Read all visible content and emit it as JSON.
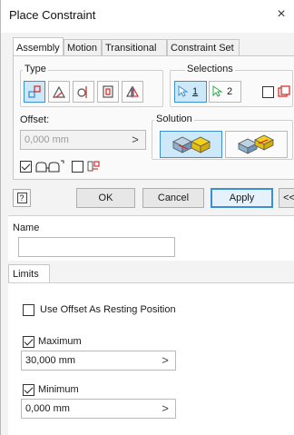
{
  "window": {
    "title": "Place Constraint",
    "close_glyph": "×"
  },
  "tabs": [
    {
      "label": "Assembly",
      "active": true
    },
    {
      "label": "Motion",
      "active": false
    },
    {
      "label": "Transitional",
      "active": false
    },
    {
      "label": "Constraint Set",
      "active": false
    }
  ],
  "type_group": {
    "label": "Type",
    "buttons": [
      "mate-icon",
      "angle-icon",
      "tangent-icon",
      "insert-icon",
      "symmetry-icon"
    ],
    "selected_index": 0
  },
  "selections_group": {
    "label": "Selections",
    "first_label": "1",
    "second_label": "2",
    "pick_part_first_checked": false
  },
  "offset": {
    "label": "Offset:",
    "value": "0,000 mm",
    "disabled": true,
    "spin_glyph": ">"
  },
  "solution_group": {
    "label": "Solution",
    "selected_index": 0
  },
  "show_preview": {
    "checked": true
  },
  "predict_offset": {
    "checked": false
  },
  "buttons": {
    "help": "?",
    "ok": "OK",
    "cancel": "Cancel",
    "apply": "Apply",
    "more": "<<"
  },
  "name_section": {
    "label": "Name",
    "value": ""
  },
  "limits_section": {
    "tab_label": "Limits",
    "use_offset_resting": {
      "label": "Use Offset As Resting Position",
      "checked": false
    },
    "maximum": {
      "label": "Maximum",
      "checked": true,
      "value": "30,000 mm",
      "spin_glyph": ">"
    },
    "minimum": {
      "label": "Minimum",
      "checked": true,
      "value": "0,000 mm",
      "spin_glyph": ">"
    }
  },
  "colors": {
    "accent": "#3c8fd0",
    "pressed_bg": "#cde8f8",
    "solution_selected_bg": "#cde8f8",
    "mate_red": "#d9302c",
    "highlight_yellow": "#f5d21a"
  }
}
